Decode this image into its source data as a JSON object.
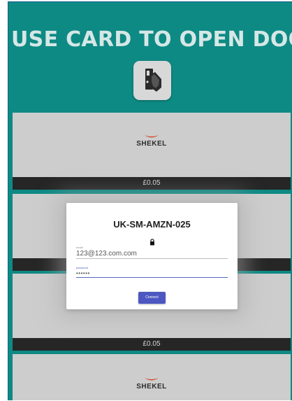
{
  "header": {
    "title": "USE CARD TO OPEN DOOR",
    "icon": "hand-card-door-icon"
  },
  "tiles": [
    {
      "brand": "SHEKEL",
      "price": "£0.05"
    },
    {
      "brand": "",
      "price": ""
    },
    {
      "brand": "",
      "price": "£0.05"
    },
    {
      "brand": "SHEKEL",
      "price": ""
    }
  ],
  "modal": {
    "title": "UK-SM-AMZN-025",
    "lock_icon": "lock-icon",
    "email_label": "email",
    "email_value": "123@123.com.com",
    "password_label": "password",
    "password_value": "••••••",
    "connect_label": "Connect"
  },
  "colors": {
    "background": "#0e8a84",
    "tile": "#cdcdcd",
    "price_bar": "#262626",
    "button": "#4c57c1",
    "brand_swoosh": "#d5482a"
  }
}
